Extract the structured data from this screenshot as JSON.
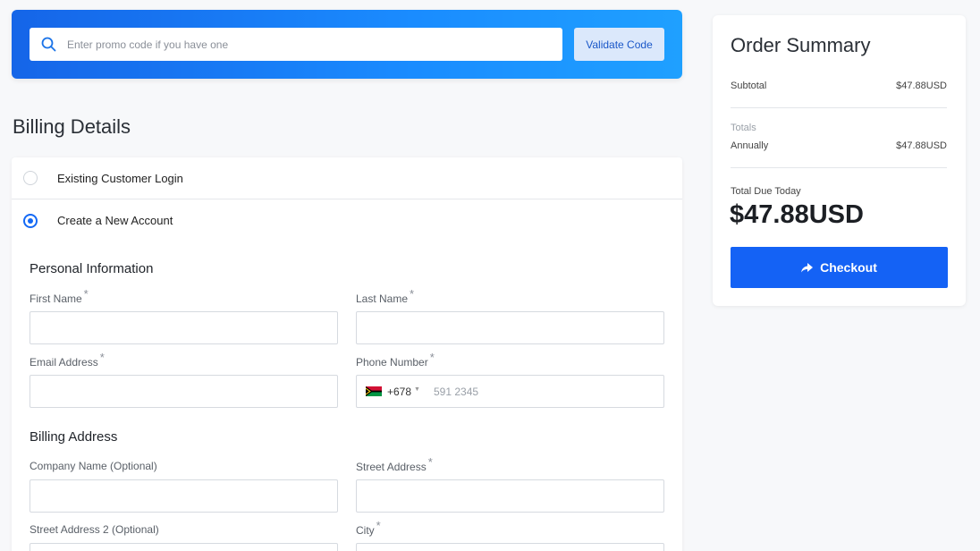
{
  "promo": {
    "placeholder": "Enter promo code if you have one",
    "validate_label": "Validate Code"
  },
  "billing": {
    "title": "Billing Details",
    "options": [
      {
        "label": "Existing Customer Login",
        "selected": false
      },
      {
        "label": "Create a New Account",
        "selected": true
      }
    ],
    "personal_title": "Personal Information",
    "address_title": "Billing Address",
    "required_mark": "*",
    "fields": {
      "first_name": "First Name",
      "last_name": "Last Name",
      "email": "Email Address",
      "phone": "Phone Number",
      "company": "Company Name (Optional)",
      "street": "Street Address",
      "street2": "Street Address 2 (Optional)",
      "city": "City"
    },
    "phone": {
      "country_code": "+678",
      "placeholder": "591 2345"
    }
  },
  "summary": {
    "title": "Order Summary",
    "subtotal_label": "Subtotal",
    "subtotal_value": "$47.88USD",
    "totals_label": "Totals",
    "annually_label": "Annually",
    "annually_value": "$47.88USD",
    "due_label": "Total Due Today",
    "due_amount": "$47.88USD",
    "checkout_label": "Checkout"
  },
  "colors": {
    "accent": "#1462f5",
    "promo_gradient_start": "#1565e8",
    "promo_gradient_end": "#1fa0ff"
  }
}
